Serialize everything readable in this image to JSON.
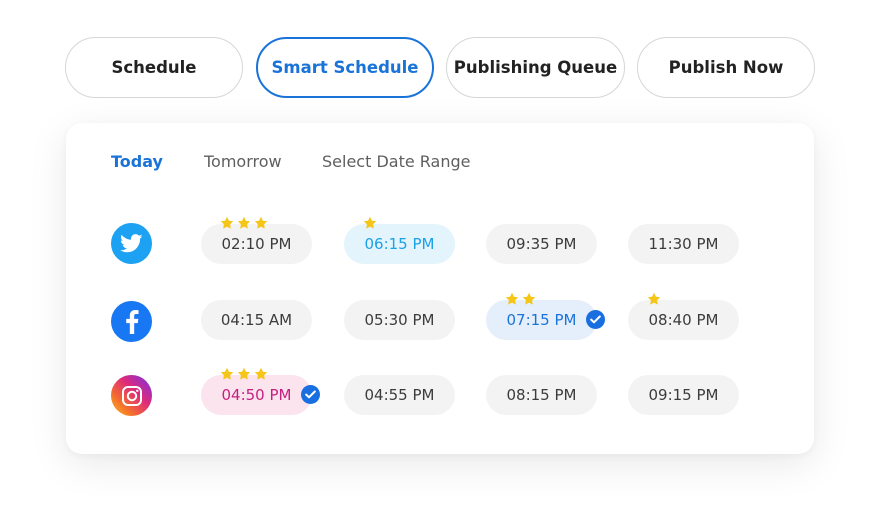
{
  "modes": [
    {
      "label": "Schedule",
      "active": false
    },
    {
      "label": "Smart Schedule",
      "active": true
    },
    {
      "label": "Publishing Queue",
      "active": false
    },
    {
      "label": "Publish Now",
      "active": false
    }
  ],
  "tabs": [
    {
      "label": "Today",
      "active": true
    },
    {
      "label": "Tomorrow",
      "active": false
    },
    {
      "label": "Select Date Range",
      "active": false
    }
  ],
  "rows": [
    {
      "network": "twitter",
      "icon": "twitter-icon",
      "slots": [
        {
          "time": "02:10 PM",
          "stars": 3,
          "highlight": false,
          "selected": false
        },
        {
          "time": "06:15 PM",
          "stars": 1,
          "highlight": true,
          "selected": false
        },
        {
          "time": "09:35 PM",
          "stars": 0,
          "highlight": false,
          "selected": false
        },
        {
          "time": "11:30 PM",
          "stars": 0,
          "highlight": false,
          "selected": false
        }
      ]
    },
    {
      "network": "facebook",
      "icon": "facebook-icon",
      "slots": [
        {
          "time": "04:15 AM",
          "stars": 0,
          "highlight": false,
          "selected": false
        },
        {
          "time": "05:30 PM",
          "stars": 0,
          "highlight": false,
          "selected": false
        },
        {
          "time": "07:15 PM",
          "stars": 2,
          "highlight": true,
          "selected": true
        },
        {
          "time": "08:40 PM",
          "stars": 1,
          "highlight": false,
          "selected": false
        }
      ]
    },
    {
      "network": "instagram",
      "icon": "instagram-icon",
      "slots": [
        {
          "time": "04:50 PM",
          "stars": 3,
          "highlight": true,
          "selected": true
        },
        {
          "time": "04:55 PM",
          "stars": 0,
          "highlight": false,
          "selected": false
        },
        {
          "time": "08:15 PM",
          "stars": 0,
          "highlight": false,
          "selected": false
        },
        {
          "time": "09:15 PM",
          "stars": 0,
          "highlight": false,
          "selected": false
        }
      ]
    }
  ],
  "colors": {
    "accent": "#1a73d8",
    "star": "#f5c518",
    "twitter": "#1da1f2",
    "facebook": "#1877f2",
    "instagram_highlight": "#fce4ef",
    "twitter_highlight": "#e4f4fc",
    "facebook_highlight": "#e5effb"
  }
}
